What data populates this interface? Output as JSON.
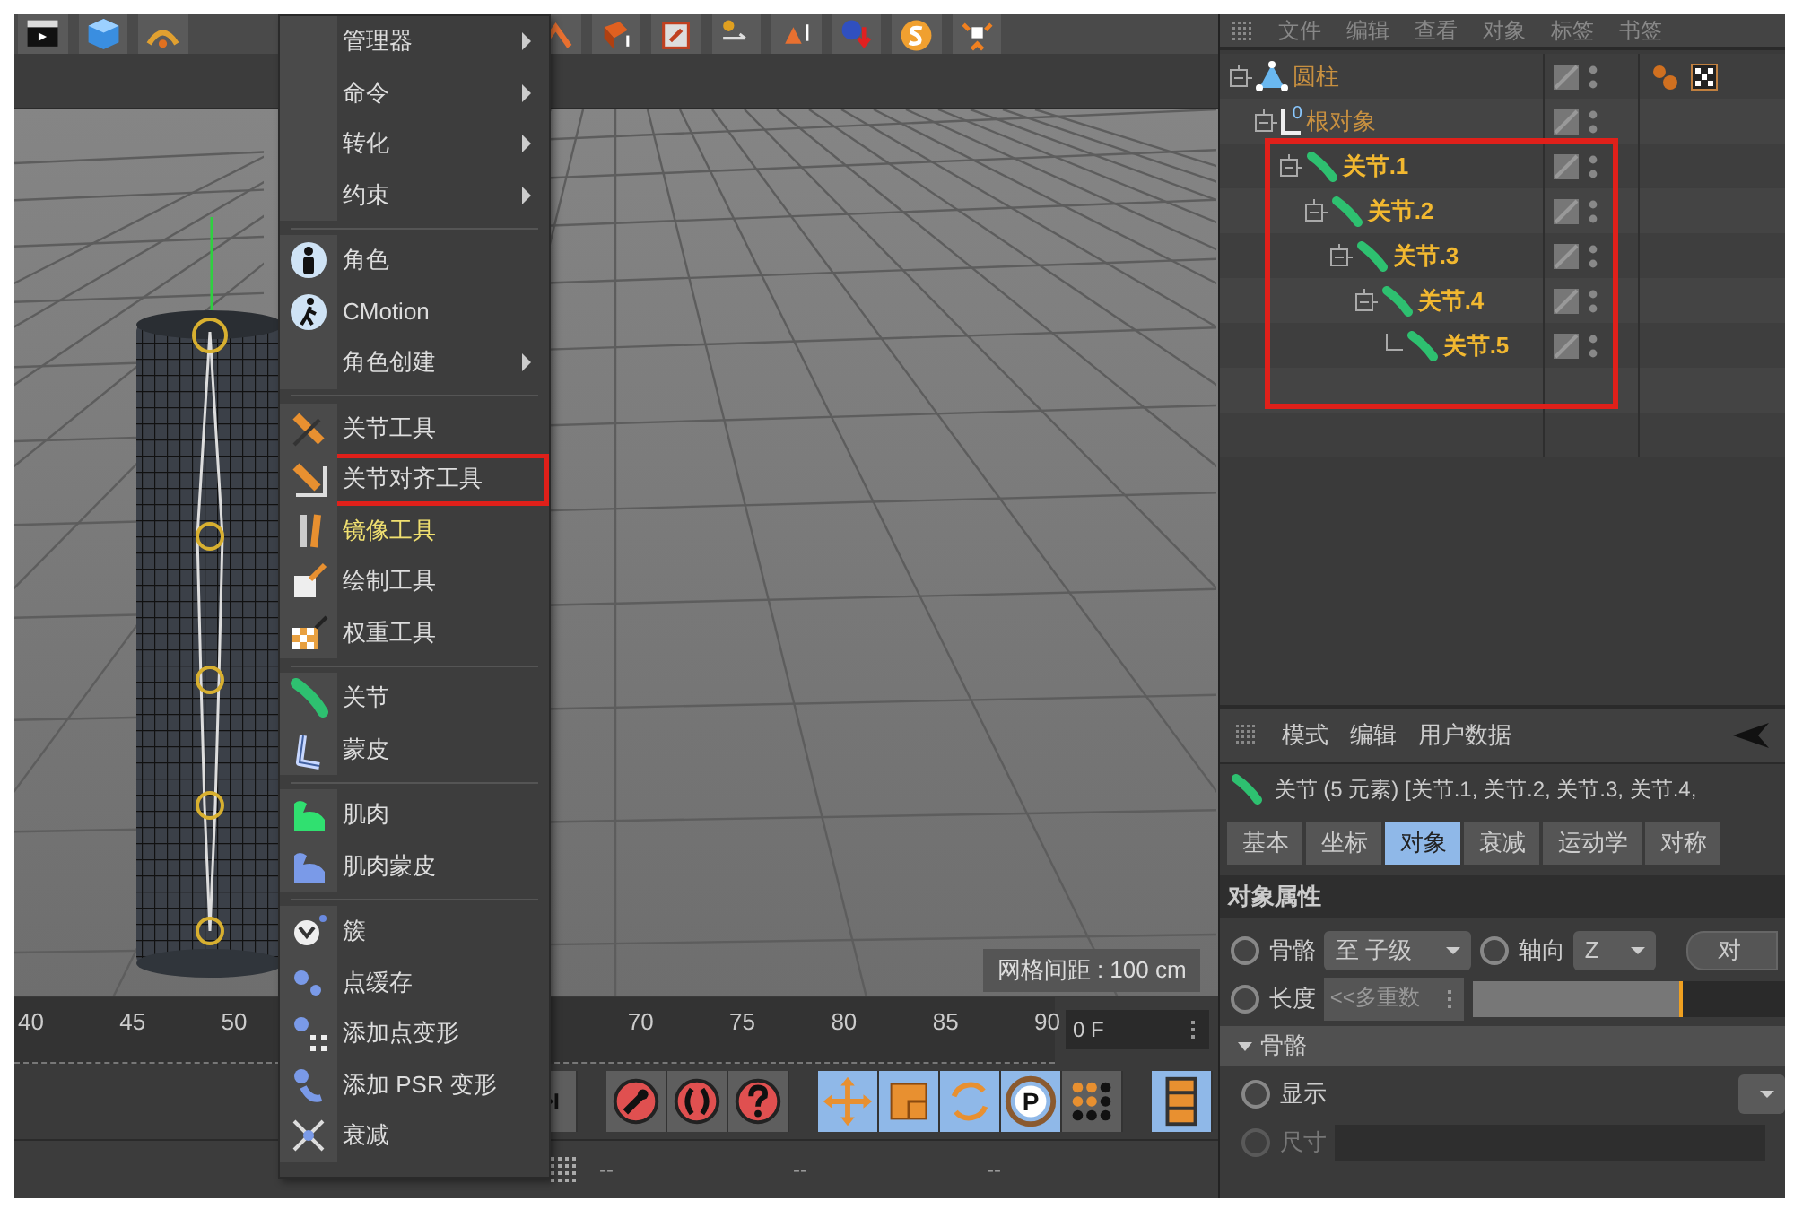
{
  "menu": {
    "items": [
      {
        "kind": "item",
        "label": "管理器",
        "submenu": true,
        "highlighted": false,
        "annotated": false
      },
      {
        "kind": "item",
        "label": "命令",
        "submenu": true,
        "highlighted": false,
        "annotated": false
      },
      {
        "kind": "item",
        "label": "转化",
        "submenu": true,
        "highlighted": false,
        "annotated": false
      },
      {
        "kind": "item",
        "label": "约束",
        "submenu": true,
        "highlighted": false,
        "annotated": false
      },
      {
        "kind": "separator"
      },
      {
        "kind": "item",
        "label": "角色",
        "submenu": false,
        "highlighted": false,
        "annotated": false
      },
      {
        "kind": "item",
        "label": "CMotion",
        "submenu": false,
        "highlighted": false,
        "annotated": false
      },
      {
        "kind": "item",
        "label": "角色创建",
        "submenu": true,
        "highlighted": false,
        "annotated": false
      },
      {
        "kind": "separator"
      },
      {
        "kind": "item",
        "label": "关节工具",
        "submenu": false,
        "highlighted": false,
        "annotated": false
      },
      {
        "kind": "item",
        "label": "关节对齐工具",
        "submenu": false,
        "highlighted": false,
        "annotated": true
      },
      {
        "kind": "item",
        "label": "镜像工具",
        "submenu": false,
        "highlighted": true,
        "annotated": false
      },
      {
        "kind": "item",
        "label": "绘制工具",
        "submenu": false,
        "highlighted": false,
        "annotated": false
      },
      {
        "kind": "item",
        "label": "权重工具",
        "submenu": false,
        "highlighted": false,
        "annotated": false
      },
      {
        "kind": "separator"
      },
      {
        "kind": "item",
        "label": "关节",
        "submenu": false,
        "highlighted": false,
        "annotated": false
      },
      {
        "kind": "item",
        "label": "蒙皮",
        "submenu": false,
        "highlighted": false,
        "annotated": false
      },
      {
        "kind": "separator"
      },
      {
        "kind": "item",
        "label": "肌肉",
        "submenu": false,
        "highlighted": false,
        "annotated": false
      },
      {
        "kind": "item",
        "label": "肌肉蒙皮",
        "submenu": false,
        "highlighted": false,
        "annotated": false
      },
      {
        "kind": "separator"
      },
      {
        "kind": "item",
        "label": "簇",
        "submenu": false,
        "highlighted": false,
        "annotated": false
      },
      {
        "kind": "item",
        "label": "点缓存",
        "submenu": false,
        "highlighted": false,
        "annotated": false
      },
      {
        "kind": "item",
        "label": "添加点变形",
        "submenu": false,
        "highlighted": false,
        "annotated": false
      },
      {
        "kind": "item",
        "label": "添加 PSR 变形",
        "submenu": false,
        "highlighted": false,
        "annotated": false
      },
      {
        "kind": "item",
        "label": "衰减",
        "submenu": false,
        "highlighted": false,
        "annotated": false
      }
    ]
  },
  "viewport": {
    "grid_spacing": "网格间距 : 100 cm"
  },
  "timeline": {
    "ruler_labels": [
      "40",
      "45",
      "50",
      "70",
      "75",
      "80",
      "85",
      "90"
    ],
    "frame": "0 F"
  },
  "transport": {
    "tools": [
      {
        "selected": false
      },
      {
        "selected": false
      },
      {
        "selected": false
      },
      {
        "selected": false
      },
      {
        "selected": true
      },
      {
        "selected": true
      },
      {
        "selected": true
      },
      {
        "selected": true,
        "label": "P"
      },
      {
        "selected": false
      },
      {
        "selected": true
      }
    ]
  },
  "status_bar": [
    "--",
    "--",
    "--"
  ],
  "object_manager": {
    "menu": [
      "文件",
      "编辑",
      "查看",
      "对象",
      "标签",
      "书签"
    ],
    "tree": [
      {
        "kind": "cylinder",
        "name": "圆柱",
        "selected": false,
        "annotated": false,
        "tagged": true,
        "children": [
          {
            "kind": "null",
            "icon_label": "0",
            "name": "根对象",
            "selected": false,
            "annotated": false,
            "tagged": false,
            "children": [
              {
                "kind": "joint",
                "name": "关节.1",
                "selected": true,
                "annotated": true,
                "tagged": false,
                "children": [
                  {
                    "kind": "joint",
                    "name": "关节.2",
                    "selected": true,
                    "annotated": true,
                    "tagged": false,
                    "children": [
                      {
                        "kind": "joint",
                        "name": "关节.3",
                        "selected": true,
                        "annotated": true,
                        "tagged": false,
                        "children": [
                          {
                            "kind": "joint",
                            "name": "关节.4",
                            "selected": true,
                            "annotated": true,
                            "tagged": false,
                            "children": [
                              {
                                "kind": "joint",
                                "name": "关节.5",
                                "selected": true,
                                "annotated": true,
                                "tagged": false
                              }
                            ]
                          }
                        ]
                      }
                    ]
                  }
                ]
              }
            ]
          }
        ]
      }
    ]
  },
  "attribute_manager": {
    "menu": [
      "模式",
      "编辑",
      "用户数据"
    ],
    "title": "关节 (5 元素) [关节.1, 关节.2, 关节.3, 关节.4,",
    "tabs": [
      {
        "label": "基本",
        "selected": false
      },
      {
        "label": "坐标",
        "selected": false
      },
      {
        "label": "对象",
        "selected": true
      },
      {
        "label": "衰减",
        "selected": false
      },
      {
        "label": "运动学",
        "selected": false
      },
      {
        "label": "对称",
        "selected": false
      }
    ],
    "section": "对象属性",
    "bone_label": "骨骼",
    "bone_checked": false,
    "bone_value": "至 子级",
    "axis_label": "轴向",
    "axis_checked": false,
    "axis_value": "Z",
    "align_button": "对",
    "length_label": "长度",
    "length_checked": false,
    "length_value": "<<多重数",
    "length_slider": {
      "level": 0.67
    },
    "group": "骨骼",
    "display_label": "显示",
    "display_checked": false,
    "size_label": "尺寸",
    "size_checked": false,
    "size_disabled": true
  }
}
